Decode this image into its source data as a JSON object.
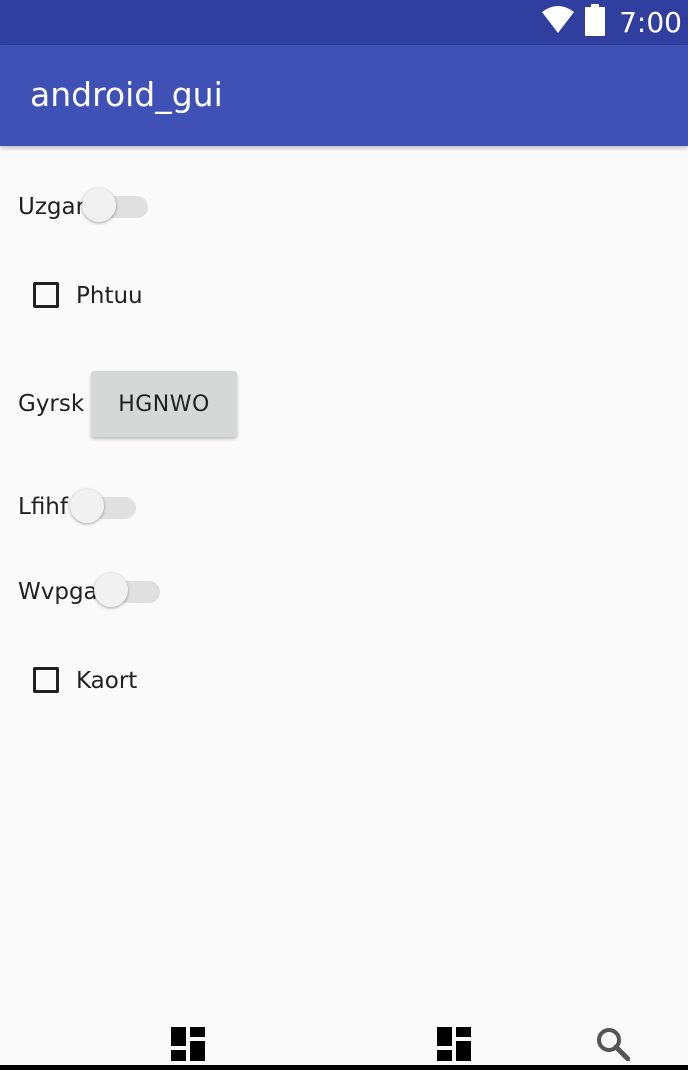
{
  "status_bar": {
    "time": "7:00",
    "wifi_icon": "wifi-icon",
    "battery_icon": "battery-icon",
    "background_color": "#303f9f"
  },
  "app_bar": {
    "title": "android_gui",
    "background_color": "#3f51b5"
  },
  "controls": {
    "switch_1": {
      "label": "Uzgar",
      "checked": false
    },
    "checkbox_1": {
      "label": "Phtuu",
      "checked": false
    },
    "button_row": {
      "label": "Gyrsk",
      "button_text": "HGNWO"
    },
    "switch_2": {
      "label": "Lfihf",
      "checked": false
    },
    "switch_3": {
      "label": "Wvpga",
      "checked": false
    },
    "checkbox_2": {
      "label": "Kaort",
      "checked": false
    }
  },
  "bottom_nav": {
    "items": [
      {
        "icon": "dashboard-icon"
      },
      {
        "icon": "dashboard-icon"
      },
      {
        "icon": "search-icon"
      }
    ]
  }
}
